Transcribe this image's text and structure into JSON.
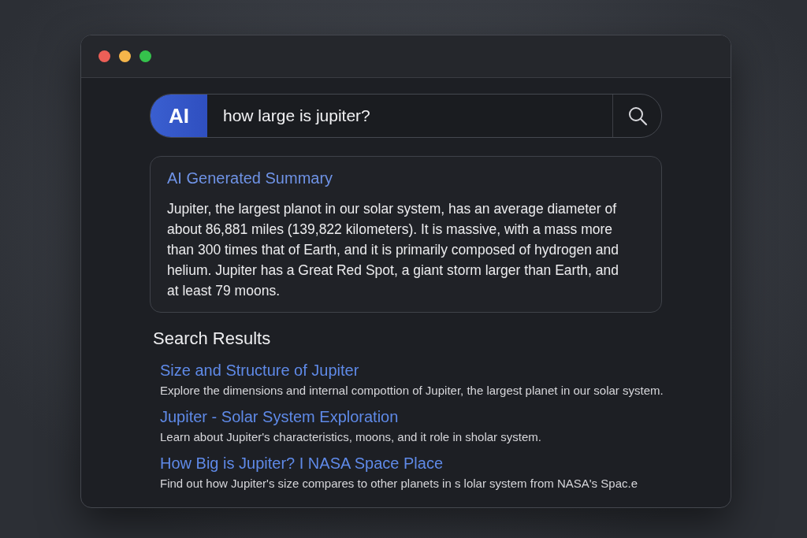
{
  "search": {
    "badge": "AI",
    "value": "how large is jupiter?"
  },
  "summary": {
    "title": "AI Generated Summary",
    "text": "Jupiter, the largest planot in our solar system, has an average diameter of about 86,881 miles (139,822 kilometers). It is massive, with a mass more than 300 times that of Earth, and it is primarily composed of hydrogen and helium. Jupiter has a Great Red Spot, a giant storm larger than Earth, and at least 79 moons."
  },
  "results_heading": "Search Results",
  "results": [
    {
      "title": "Size and Structure of Jupiter",
      "description": "Explore the dimensions and internal compottion of Jupiter, the largest planet in our solar system."
    },
    {
      "title": "Jupiter - Solar System Exploration",
      "description": "Learn about Jupiter's characteristics, moons, and it role in sholar system."
    },
    {
      "title": "How Big is Jupiter? I NASA Space Place",
      "description": "Find out how Jupiter's size compares to other planets in s lolar system from NASA's Spac.e"
    }
  ]
}
